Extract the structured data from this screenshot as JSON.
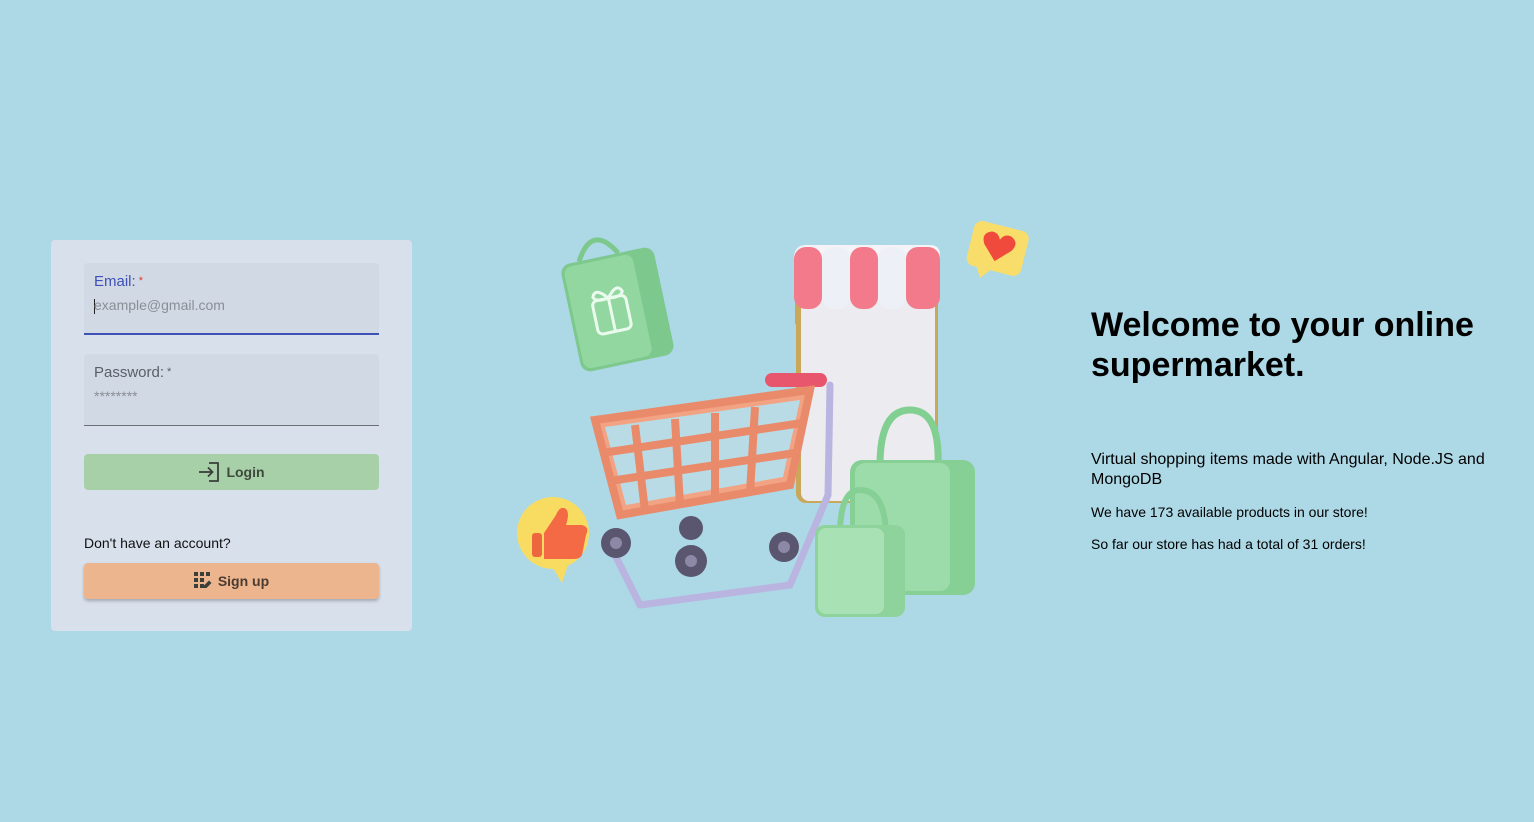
{
  "login_form": {
    "email_label": "Email:",
    "email_required_mark": "*",
    "email_placeholder": "example@gmail.com",
    "email_value": "",
    "password_label": "Password:",
    "password_required_mark": "*",
    "password_placeholder": "********",
    "password_value": "",
    "login_label": "Login",
    "no_account_text": "Don't have an account?",
    "signup_label": "Sign up"
  },
  "hero": {
    "title": "Welcome to your online supermarket.",
    "description": "Virtual shopping items made with Angular, Node.JS and MongoDB",
    "products_text": "We have 173 available products in our store!",
    "orders_text": "So far our store has had a total of 31 orders!"
  },
  "icons": {
    "login": "login-icon",
    "signup": "app-registration-icon"
  },
  "colors": {
    "background": "#add8e6",
    "card": "#d8e0ec",
    "primary": "#3f51b5",
    "login_button": "#a8d0a8",
    "signup_button": "#edb58d"
  }
}
